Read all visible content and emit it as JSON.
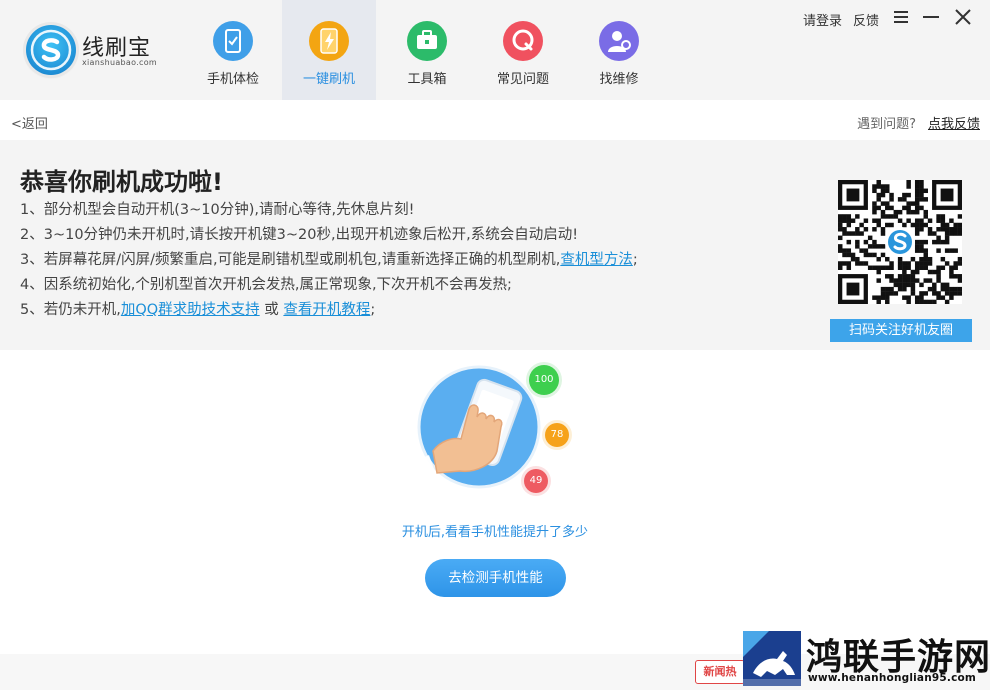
{
  "app": {
    "brand_cn": "线刷宝",
    "brand_en": "xianshuabao.com"
  },
  "nav": {
    "items": [
      {
        "label": "手机体检",
        "icon": "phone-check-icon",
        "color": "#3f9fe8"
      },
      {
        "label": "一键刷机",
        "icon": "flash-icon",
        "color": "#f3a512",
        "active": true
      },
      {
        "label": "工具箱",
        "icon": "toolbox-icon",
        "color": "#2cbb6a"
      },
      {
        "label": "常见问题",
        "icon": "faq-icon",
        "color": "#f0515f"
      },
      {
        "label": "找维修",
        "icon": "repair-icon",
        "color": "#7a6ce6"
      }
    ]
  },
  "header": {
    "login": "请登录",
    "feedback": "反馈"
  },
  "subbar": {
    "back": "<返回",
    "problem": "遇到问题?",
    "feedback_link": "点我反馈"
  },
  "success": {
    "title": "恭喜你刷机成功啦!",
    "step1": "1、部分机型会自动开机(3~10分钟),请耐心等待,先休息片刻!",
    "step2": "2、3~10分钟仍未开机时,请长按开机键3~20秒,出现开机迹象后松开,系统会自动启动!",
    "step3_prefix": "3、若屏幕花屏/闪屏/频繁重启,可能是刷错机型或刷机包,请重新选择正确的机型刷机,",
    "step3_link": "查机型方法",
    "step3_suffix": ";",
    "step4": "4、因系统初始化,个别机型首次开机会发热,属正常现象,下次开机不会再发热;",
    "step5_prefix": "5、若仍未开机,",
    "step5_link1": "加QQ群求助技术支持",
    "step5_mid": " 或 ",
    "step5_link2": "查看开机教程",
    "step5_suffix": ";",
    "qr_caption": "扫码关注好机友圈"
  },
  "perf": {
    "scores": [
      "100",
      "78",
      "49"
    ],
    "text": "开机后,看看手机性能提升了多少",
    "button": "去检测手机性能"
  },
  "watermark": {
    "badge": "新闻热",
    "title": "鸿联手游网",
    "url": "www.henanhonglian95.com"
  },
  "colors": {
    "accent": "#2a8fe0",
    "link": "#1a8fd8",
    "button": "#3da4ea"
  }
}
